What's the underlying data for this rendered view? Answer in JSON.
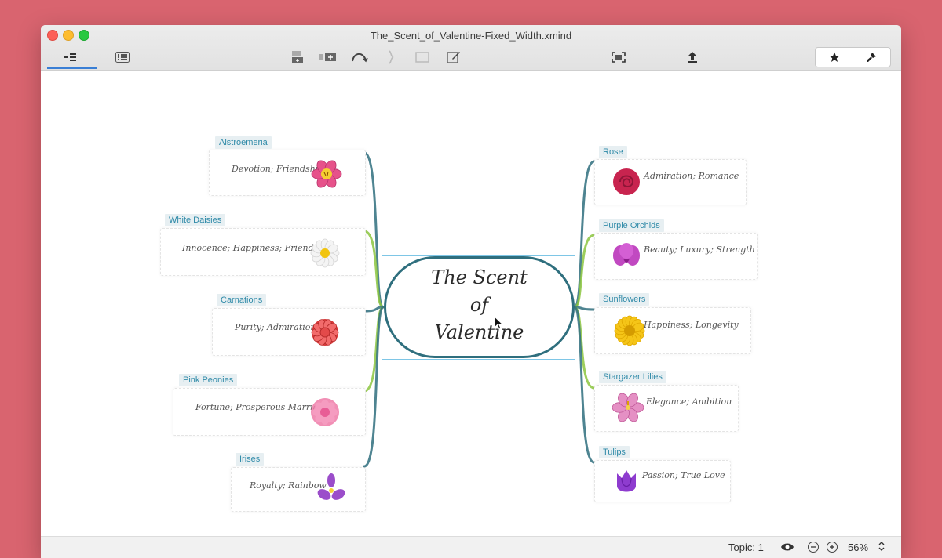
{
  "window": {
    "title": "The_Scent_of_Valentine-Fixed_Width.xmind"
  },
  "toolbar": {
    "left": [
      {
        "name": "outline-view-icon"
      },
      {
        "name": "list-view-icon"
      }
    ],
    "center": [
      {
        "name": "insert-topic-icon"
      },
      {
        "name": "insert-subtopic-icon"
      },
      {
        "name": "relationship-icon"
      },
      {
        "name": "summary-icon"
      },
      {
        "name": "boundary-icon"
      },
      {
        "name": "notes-icon"
      }
    ],
    "right": [
      {
        "name": "fullscreen-icon"
      },
      {
        "name": "share-icon"
      },
      {
        "name": "favorite-star-icon"
      },
      {
        "name": "format-brush-icon"
      }
    ]
  },
  "central_topic": {
    "line1": "The Scent",
    "line2": "of",
    "line3": "Valentine"
  },
  "topics_left": [
    {
      "label": "Alstroemeria",
      "text": "Devotion; Friendship",
      "flower": "alstroemeria-icon",
      "color": "#e6528a"
    },
    {
      "label": "White Daisies",
      "text": "Innocence; Happiness; Friendship",
      "flower": "daisy-icon",
      "color": "#f1c40f"
    },
    {
      "label": "Carnations",
      "text": "Purity; Admiration",
      "flower": "carnation-icon",
      "color": "#d93b3b"
    },
    {
      "label": "Pink Peonies",
      "text": "Fortune; Prosperous Marriage",
      "flower": "peony-icon",
      "color": "#ef7ba8"
    },
    {
      "label": "Irises",
      "text": "Royalty; Rainbow",
      "flower": "iris-icon",
      "color": "#9b4dca"
    }
  ],
  "topics_right": [
    {
      "label": "Rose",
      "text": "Admiration; Romance",
      "flower": "rose-icon",
      "color": "#c8244f"
    },
    {
      "label": "Purple Orchids",
      "text": "Beauty; Luxury; Strength",
      "flower": "orchid-icon",
      "color": "#c149c1"
    },
    {
      "label": "Sunflowers",
      "text": "Happiness; Longevity",
      "flower": "sunflower-icon",
      "color": "#f5c518"
    },
    {
      "label": "Stargazer Lilies",
      "text": "Elegance; Ambition",
      "flower": "lily-icon",
      "color": "#e590c4"
    },
    {
      "label": "Tulips",
      "text": "Passion; True Love",
      "flower": "tulip-icon",
      "color": "#8e3ccf"
    }
  ],
  "status": {
    "topic_count": "Topic: 1",
    "zoom": "56%"
  },
  "colors": {
    "branch_teal": "#2f6f7e",
    "branch_green": "#8cc63f",
    "label_text": "#2f8aa8",
    "background": "#d9646f"
  }
}
